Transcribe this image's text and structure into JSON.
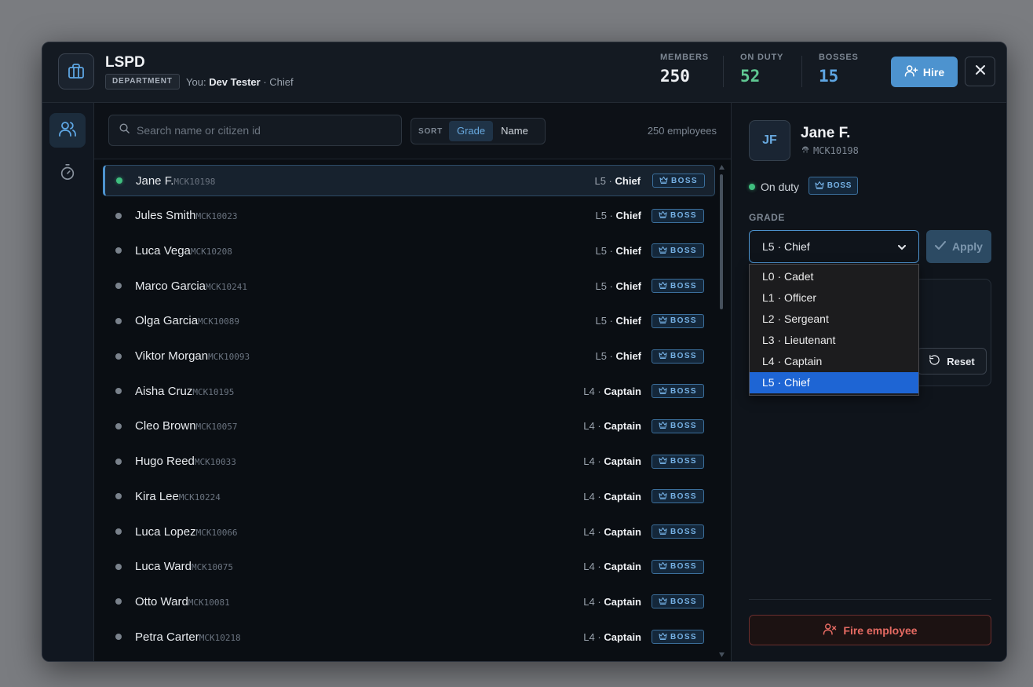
{
  "header": {
    "org_name": "LSPD",
    "badge": "DEPARTMENT",
    "you_prefix": "You:",
    "you_name": "Dev Tester",
    "you_role": "· Chief",
    "stats": [
      {
        "label": "MEMBERS",
        "value": "250",
        "color": "#eef0f3"
      },
      {
        "label": "ON DUTY",
        "value": "52",
        "color": "#5fc792"
      },
      {
        "label": "BOSSES",
        "value": "15",
        "color": "#5ea6e3"
      }
    ],
    "hire_label": "Hire"
  },
  "toolbar": {
    "search_placeholder": "Search name or citizen id",
    "sort_label": "SORT",
    "sort_options": [
      "Grade",
      "Name"
    ],
    "employee_count": "250 employees"
  },
  "employees": [
    {
      "name": "Jane F.",
      "id": "MCK10198",
      "level": "L5",
      "grade": "Chief",
      "boss": "BOSS",
      "on_duty": true,
      "selected": true
    },
    {
      "name": "Jules Smith",
      "id": "MCK10023",
      "level": "L5",
      "grade": "Chief",
      "boss": "BOSS",
      "on_duty": false
    },
    {
      "name": "Luca Vega",
      "id": "MCK10208",
      "level": "L5",
      "grade": "Chief",
      "boss": "BOSS",
      "on_duty": false
    },
    {
      "name": "Marco Garcia",
      "id": "MCK10241",
      "level": "L5",
      "grade": "Chief",
      "boss": "BOSS",
      "on_duty": false
    },
    {
      "name": "Olga Garcia",
      "id": "MCK10089",
      "level": "L5",
      "grade": "Chief",
      "boss": "BOSS",
      "on_duty": false
    },
    {
      "name": "Viktor Morgan",
      "id": "MCK10093",
      "level": "L5",
      "grade": "Chief",
      "boss": "BOSS",
      "on_duty": false
    },
    {
      "name": "Aisha Cruz",
      "id": "MCK10195",
      "level": "L4",
      "grade": "Captain",
      "boss": "BOSS",
      "on_duty": false
    },
    {
      "name": "Cleo Brown",
      "id": "MCK10057",
      "level": "L4",
      "grade": "Captain",
      "boss": "BOSS",
      "on_duty": false
    },
    {
      "name": "Hugo Reed",
      "id": "MCK10033",
      "level": "L4",
      "grade": "Captain",
      "boss": "BOSS",
      "on_duty": false
    },
    {
      "name": "Kira Lee",
      "id": "MCK10224",
      "level": "L4",
      "grade": "Captain",
      "boss": "BOSS",
      "on_duty": false
    },
    {
      "name": "Luca Lopez",
      "id": "MCK10066",
      "level": "L4",
      "grade": "Captain",
      "boss": "BOSS",
      "on_duty": false
    },
    {
      "name": "Luca Ward",
      "id": "MCK10075",
      "level": "L4",
      "grade": "Captain",
      "boss": "BOSS",
      "on_duty": false
    },
    {
      "name": "Otto Ward",
      "id": "MCK10081",
      "level": "L4",
      "grade": "Captain",
      "boss": "BOSS",
      "on_duty": false
    },
    {
      "name": "Petra Carter",
      "id": "MCK10218",
      "level": "L4",
      "grade": "Captain",
      "boss": "BOSS",
      "on_duty": false
    }
  ],
  "detail": {
    "initials": "JF",
    "name": "Jane F.",
    "citizen_id": "MCK10198",
    "status": "On duty",
    "boss": "BOSS",
    "grade_label": "GRADE",
    "grade_value": "L5 · Chief",
    "apply_label": "Apply",
    "reset_label": "Reset",
    "grade_options": [
      "L0 · Cadet",
      "L1 · Officer",
      "L2 · Sergeant",
      "L3 · Lieutenant",
      "L4 · Captain",
      "L5 · Chief"
    ],
    "selected_option": "L5 · Chief",
    "fire_label": "Fire employee"
  },
  "colors": {
    "accent": "#4d93cf",
    "on_duty": "#3fbf7f",
    "danger": "#e56a62"
  }
}
